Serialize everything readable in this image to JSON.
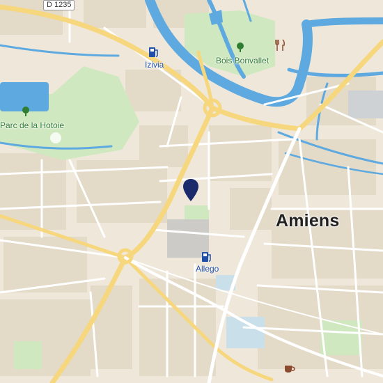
{
  "map": {
    "city_label": "Amiens",
    "road_shield": "D 1235",
    "parks": [
      {
        "label": "Parc de la Hotoie"
      },
      {
        "label": "Bois Bonvallet"
      }
    ],
    "poi": [
      {
        "label": "Izivia",
        "icon": "ev-charging-icon"
      },
      {
        "label": "Allego",
        "icon": "ev-charging-icon"
      },
      {
        "label": "",
        "icon": "restaurant-icon"
      },
      {
        "label": "",
        "icon": "cafe-icon"
      }
    ],
    "marker": {
      "icon": "location-pin-icon"
    },
    "colors": {
      "land": "#efe8da",
      "water": "#5ea9df",
      "park": "#cfe8bf",
      "major_road": "#f6d77d",
      "minor_road": "#ffffff",
      "building": "#e3dac8",
      "marker": "#1b2a6b",
      "poi": "#1f4fa8",
      "park_text": "#2f7d32"
    }
  }
}
